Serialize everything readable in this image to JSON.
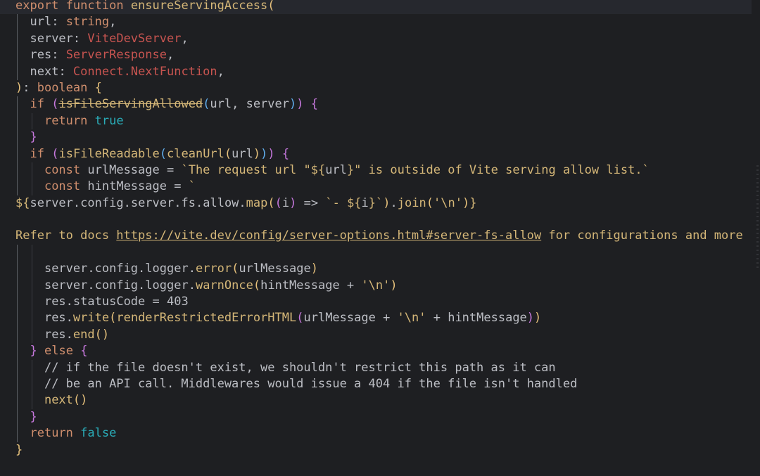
{
  "lines": [
    {
      "tokens": [
        {
          "t": "export",
          "c": "kw"
        },
        {
          "t": " "
        },
        {
          "t": "function",
          "c": "kw"
        },
        {
          "t": " "
        },
        {
          "t": "ensureServingAccess",
          "c": "y"
        },
        {
          "t": "(",
          "c": "br1"
        }
      ],
      "current": true,
      "indent": 0
    },
    {
      "tokens": [
        {
          "t": "url",
          "c": "plain"
        },
        {
          "t": ": "
        },
        {
          "t": "string",
          "c": "kw"
        },
        {
          "t": ","
        }
      ],
      "indent": 1
    },
    {
      "tokens": [
        {
          "t": "server",
          "c": "plain"
        },
        {
          "t": ": "
        },
        {
          "t": "ViteDevServer",
          "c": "type"
        },
        {
          "t": ","
        }
      ],
      "indent": 1
    },
    {
      "tokens": [
        {
          "t": "res",
          "c": "plain"
        },
        {
          "t": ": "
        },
        {
          "t": "ServerResponse",
          "c": "type"
        },
        {
          "t": ","
        }
      ],
      "indent": 1
    },
    {
      "tokens": [
        {
          "t": "next",
          "c": "plain"
        },
        {
          "t": ": "
        },
        {
          "t": "Connect",
          "c": "type"
        },
        {
          "t": ".",
          "c": "type"
        },
        {
          "t": "NextFunction",
          "c": "type"
        },
        {
          "t": ","
        }
      ],
      "indent": 1
    },
    {
      "tokens": [
        {
          "t": ")",
          "c": "br1"
        },
        {
          "t": ": "
        },
        {
          "t": "boolean",
          "c": "kw"
        },
        {
          "t": " "
        },
        {
          "t": "{",
          "c": "br1"
        }
      ],
      "indent": 0
    },
    {
      "tokens": [
        {
          "t": "if",
          "c": "kw"
        },
        {
          "t": " "
        },
        {
          "t": "(",
          "c": "br2"
        },
        {
          "t": "isFileServingAllowed",
          "c": "y strike"
        },
        {
          "t": "(",
          "c": "br3"
        },
        {
          "t": "url, server"
        },
        {
          "t": ")",
          "c": "br3"
        },
        {
          "t": ")",
          "c": "br2"
        },
        {
          "t": " "
        },
        {
          "t": "{",
          "c": "br2"
        }
      ],
      "indent": 1
    },
    {
      "tokens": [
        {
          "t": "return",
          "c": "kw"
        },
        {
          "t": " "
        },
        {
          "t": "true",
          "c": "cy"
        }
      ],
      "indent": 2
    },
    {
      "tokens": [
        {
          "t": "}",
          "c": "br2"
        }
      ],
      "indent": 1
    },
    {
      "tokens": [
        {
          "t": "if",
          "c": "kw"
        },
        {
          "t": " "
        },
        {
          "t": "(",
          "c": "br2"
        },
        {
          "t": "isFileReadable",
          "c": "y"
        },
        {
          "t": "(",
          "c": "br3"
        },
        {
          "t": "cleanUrl",
          "c": "y"
        },
        {
          "t": "(",
          "c": "br1"
        },
        {
          "t": "url"
        },
        {
          "t": ")",
          "c": "br1"
        },
        {
          "t": ")",
          "c": "br3"
        },
        {
          "t": ")",
          "c": "br2"
        },
        {
          "t": " "
        },
        {
          "t": "{",
          "c": "br2"
        }
      ],
      "indent": 1
    },
    {
      "tokens": [
        {
          "t": "const",
          "c": "kw"
        },
        {
          "t": " "
        },
        {
          "t": "urlMessage",
          "c": "plain"
        },
        {
          "t": " = "
        },
        {
          "t": "`The request url \"",
          "c": "y"
        },
        {
          "t": "${",
          "c": "y"
        },
        {
          "t": "url"
        },
        {
          "t": "}",
          "c": "y"
        },
        {
          "t": "\" is outside of Vite serving allow list.`",
          "c": "y"
        }
      ],
      "indent": 2
    },
    {
      "tokens": [
        {
          "t": "const",
          "c": "kw"
        },
        {
          "t": " "
        },
        {
          "t": "hintMessage",
          "c": "plain"
        },
        {
          "t": " = "
        },
        {
          "t": "`",
          "c": "y"
        }
      ],
      "indent": 2
    },
    {
      "tokens": [
        {
          "t": "${",
          "c": "y"
        },
        {
          "t": "server"
        },
        {
          "t": "."
        },
        {
          "t": "config"
        },
        {
          "t": "."
        },
        {
          "t": "server"
        },
        {
          "t": "."
        },
        {
          "t": "fs"
        },
        {
          "t": "."
        },
        {
          "t": "allow"
        },
        {
          "t": "."
        },
        {
          "t": "map",
          "c": "y"
        },
        {
          "t": "(",
          "c": "br1"
        },
        {
          "t": "(",
          "c": "br2"
        },
        {
          "t": "i"
        },
        {
          "t": ")",
          "c": "br2"
        },
        {
          "t": " => "
        },
        {
          "t": "`- ",
          "c": "y"
        },
        {
          "t": "${",
          "c": "y"
        },
        {
          "t": "i"
        },
        {
          "t": "}",
          "c": "y"
        },
        {
          "t": "`",
          "c": "y"
        },
        {
          "t": ")",
          "c": "br1"
        },
        {
          "t": "."
        },
        {
          "t": "join",
          "c": "y"
        },
        {
          "t": "(",
          "c": "br1"
        },
        {
          "t": "'\\n'",
          "c": "y"
        },
        {
          "t": ")",
          "c": "br1"
        },
        {
          "t": "}",
          "c": "y"
        }
      ],
      "indent": 0,
      "raw": true
    },
    {
      "tokens": [],
      "indent": 0,
      "raw": true
    },
    {
      "tokens": [
        {
          "t": "Refer to docs ",
          "c": "y"
        },
        {
          "t": "https://vite.dev/config/server-options.html#server-fs-allow",
          "c": "y link"
        },
        {
          "t": " for configurations and more",
          "c": "y"
        }
      ],
      "indent": 0,
      "raw": true
    },
    {
      "tokens": [],
      "indent": 2
    },
    {
      "tokens": [
        {
          "t": "server"
        },
        {
          "t": "."
        },
        {
          "t": "config"
        },
        {
          "t": "."
        },
        {
          "t": "logger"
        },
        {
          "t": "."
        },
        {
          "t": "error",
          "c": "y"
        },
        {
          "t": "(",
          "c": "br1"
        },
        {
          "t": "urlMessage"
        },
        {
          "t": ")",
          "c": "br1"
        }
      ],
      "indent": 2
    },
    {
      "tokens": [
        {
          "t": "server"
        },
        {
          "t": "."
        },
        {
          "t": "config"
        },
        {
          "t": "."
        },
        {
          "t": "logger"
        },
        {
          "t": "."
        },
        {
          "t": "warnOnce",
          "c": "y"
        },
        {
          "t": "(",
          "c": "br1"
        },
        {
          "t": "hintMessage + "
        },
        {
          "t": "'\\n'",
          "c": "y"
        },
        {
          "t": ")",
          "c": "br1"
        }
      ],
      "indent": 2
    },
    {
      "tokens": [
        {
          "t": "res"
        },
        {
          "t": "."
        },
        {
          "t": "statusCode"
        },
        {
          "t": " = "
        },
        {
          "t": "403",
          "c": "plain"
        }
      ],
      "indent": 2
    },
    {
      "tokens": [
        {
          "t": "res"
        },
        {
          "t": "."
        },
        {
          "t": "write",
          "c": "y"
        },
        {
          "t": "(",
          "c": "br1"
        },
        {
          "t": "renderRestrictedErrorHTML",
          "c": "y"
        },
        {
          "t": "(",
          "c": "br2"
        },
        {
          "t": "urlMessage + "
        },
        {
          "t": "'\\n'",
          "c": "y"
        },
        {
          "t": " + hintMessage"
        },
        {
          "t": ")",
          "c": "br2"
        },
        {
          "t": ")",
          "c": "br1"
        }
      ],
      "indent": 2
    },
    {
      "tokens": [
        {
          "t": "res"
        },
        {
          "t": "."
        },
        {
          "t": "end",
          "c": "y"
        },
        {
          "t": "()",
          "c": "br1"
        }
      ],
      "indent": 2
    },
    {
      "tokens": [
        {
          "t": "}",
          "c": "br2"
        },
        {
          "t": " "
        },
        {
          "t": "else",
          "c": "kw"
        },
        {
          "t": " "
        },
        {
          "t": "{",
          "c": "br2"
        }
      ],
      "indent": 1
    },
    {
      "tokens": [
        {
          "t": "// if the file doesn't exist, we shouldn't restrict this path as it can"
        }
      ],
      "indent": 2
    },
    {
      "tokens": [
        {
          "t": "// be an API call. Middlewares would issue a 404 if the file isn't handled"
        }
      ],
      "indent": 2
    },
    {
      "tokens": [
        {
          "t": "next",
          "c": "y"
        },
        {
          "t": "()",
          "c": "br1"
        }
      ],
      "indent": 2
    },
    {
      "tokens": [
        {
          "t": "}",
          "c": "br2"
        }
      ],
      "indent": 1
    },
    {
      "tokens": [
        {
          "t": "return",
          "c": "kw"
        },
        {
          "t": " "
        },
        {
          "t": "false",
          "c": "cy"
        }
      ],
      "indent": 1
    },
    {
      "tokens": [
        {
          "t": "}",
          "c": "br1"
        }
      ],
      "indent": 0
    }
  ]
}
